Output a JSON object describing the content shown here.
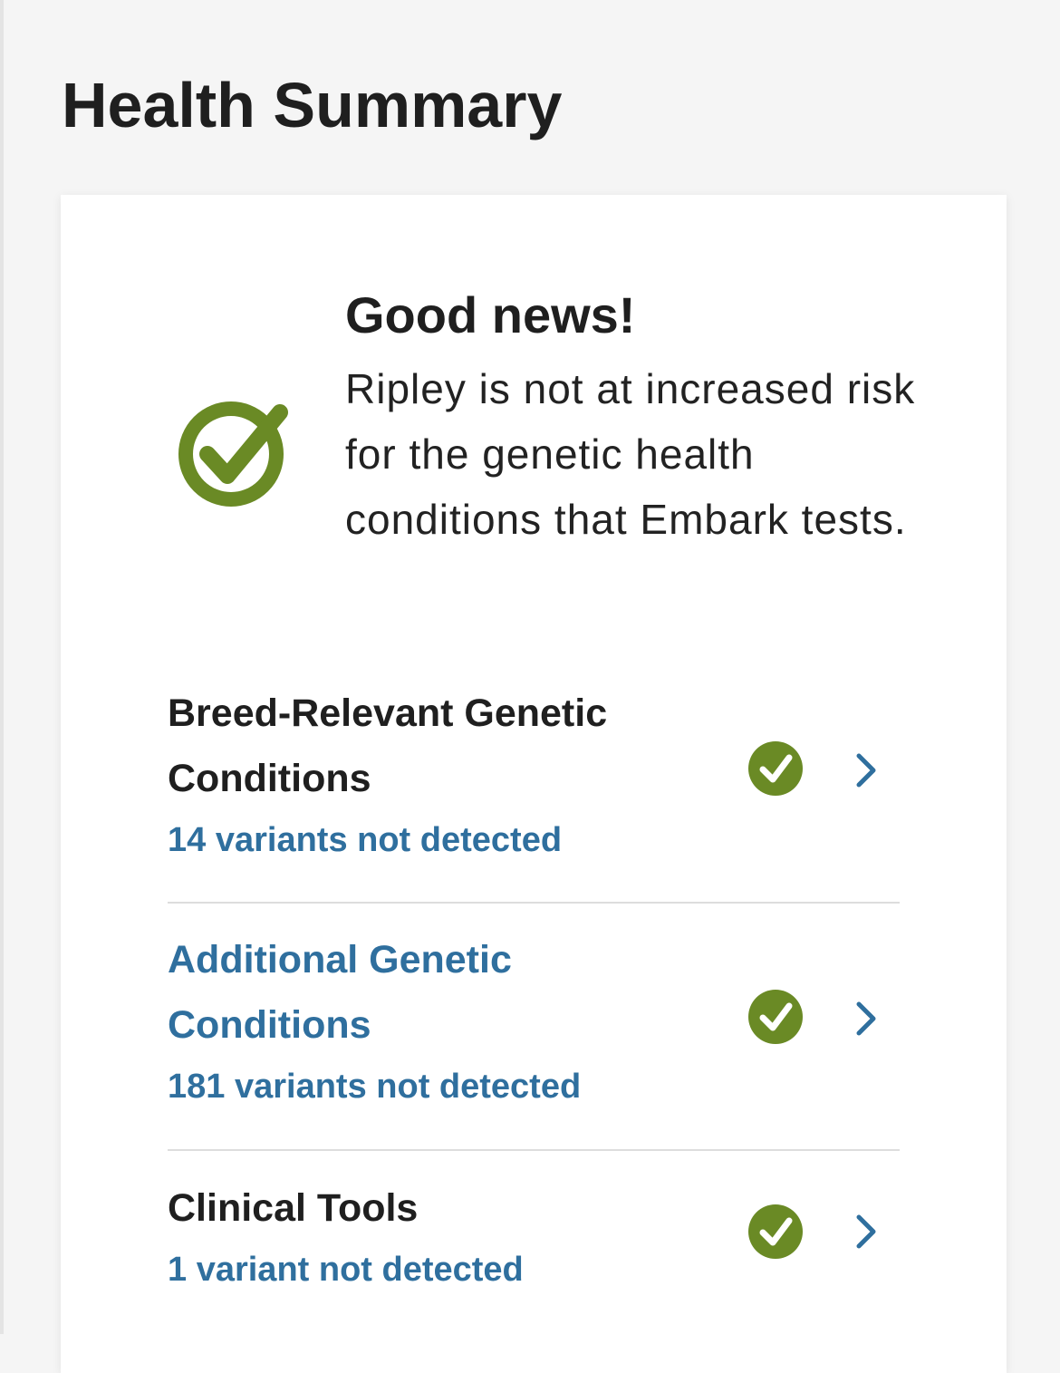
{
  "header": {
    "title": "Health Summary"
  },
  "hero": {
    "icon": "check-circle-icon",
    "heading": "Good news!",
    "body": "Ripley is not at increased risk for the genetic health conditions that Embark tests."
  },
  "rows": [
    {
      "title": "Breed-Relevant Genetic Conditions",
      "subtitle": "14 variants not detected",
      "icon": "check-circle-icon",
      "action_icon": "chevron-right-icon"
    },
    {
      "title": "Additional Genetic Conditions",
      "subtitle": "181 variants not detected",
      "icon": "check-circle-icon",
      "action_icon": "chevron-right-icon"
    },
    {
      "title": "Clinical Tools",
      "subtitle": "1 variant not detected",
      "icon": "check-circle-icon",
      "action_icon": "chevron-right-icon"
    }
  ],
  "colors": {
    "check_green": "#6a8a25",
    "link_blue": "#2f6f9e",
    "text_dark": "#1f1f1f"
  }
}
